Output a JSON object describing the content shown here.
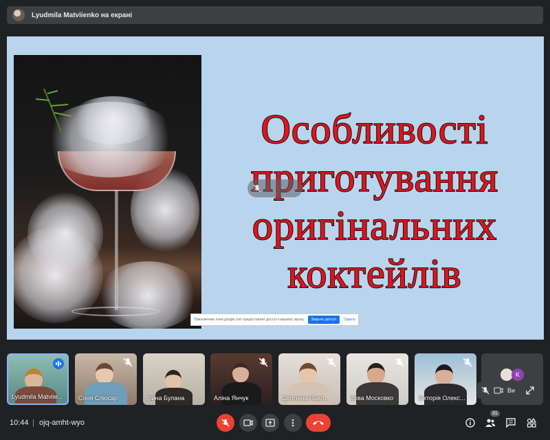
{
  "presenter_bar": {
    "text": "Lyudmila Matviienko на екрані"
  },
  "slide": {
    "title_lines": [
      "Особливості",
      "приготування",
      "оригінальних",
      "коктейлів"
    ]
  },
  "share_notice": {
    "text": "Приложению meet.google.com предоставлен доступ к вашему экрану.",
    "stop_label": "Закрыть доступ",
    "hide_label": "Скрыть"
  },
  "participants": [
    {
      "name": "Lyudmila Matviie...",
      "speaking": true
    },
    {
      "name": "Соня Слюсар",
      "muted": true
    },
    {
      "name": "Ірина Булана",
      "muted": false
    },
    {
      "name": "Аліна Янчук",
      "muted": true
    },
    {
      "name": "Світлана Павл...",
      "muted": true
    },
    {
      "name": "Вова Московко",
      "muted": true
    },
    {
      "name": "Вікторія Олекс...",
      "muted": true
    }
  ],
  "others": {
    "avatar_letter": "K",
    "you_label": "Ви"
  },
  "meeting": {
    "time": "10:44",
    "separator": "|",
    "code": "ojq-amht-wyo"
  },
  "people_count": "31",
  "colors": {
    "accent": "#1a73e8",
    "danger": "#ea4335",
    "title": "#e5121b",
    "slide_bg": "#b9d5ed",
    "app_bg": "#202124"
  }
}
